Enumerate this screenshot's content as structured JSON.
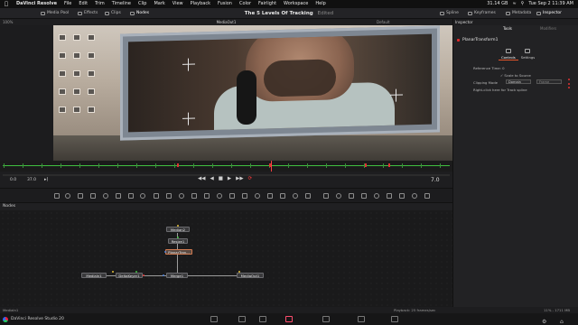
{
  "menubar": {
    "apple": "",
    "items": [
      "DaVinci Resolve",
      "File",
      "Edit",
      "Trim",
      "Timeline",
      "Clip",
      "Mark",
      "View",
      "Playback",
      "Fusion",
      "Color",
      "Fairlight",
      "Workspace",
      "Help"
    ],
    "storage": "31.14 GB",
    "datetime": "Tue Sep 2 11:39 AM"
  },
  "toolbar": {
    "media_pool": "Media Pool",
    "effects": "Effects",
    "clips": "Clips",
    "nodes": "Nodes",
    "project_title": "The 5 Levels Of Tracking",
    "edited": "Edited",
    "spline": "Spline",
    "keyframes": "Keyframes",
    "metadata": "Metadata",
    "inspector": "Inspector"
  },
  "viewer": {
    "zoom": "100%",
    "output_name": "MediaOut1",
    "mode": "Default"
  },
  "transport": {
    "start": "0.0",
    "end": "37.0",
    "current_frame": "7.0"
  },
  "nodes_panel": {
    "title": "Nodes",
    "nodes": {
      "median2": "Median2",
      "resize1": "Resize1",
      "planar": "PlanarTran...",
      "media_in": "MediaIn1",
      "delta_keyer": "DeltaKeyer1",
      "merge1": "Merge1",
      "media_out": "MediaOut1"
    }
  },
  "statusbar": {
    "left": "MediaIn1",
    "middle": "Playback: 25 frames/sec",
    "right": "11% - 1711 MB"
  },
  "pagebar": {
    "app_name": "DaVinci Resolve Studio 20"
  },
  "inspector": {
    "header": "Inspector",
    "tab_tools": "Tools",
    "tab_modifiers": "Modifiers",
    "node_name": "PlanarTransform1",
    "controls": "Controls",
    "settings": "Settings",
    "reference_time": "Reference Time: 0",
    "scale_to_source": "Scale to Source",
    "clipping_mode": "Clipping Mode",
    "domain": "Domain",
    "frame": "Frame",
    "right_click_hint": "Right-click here for Track spline"
  },
  "colors": {
    "accent_red": "#e02a2a",
    "timeline_green": "#3fbf3f",
    "selection_orange": "#e4552a"
  }
}
